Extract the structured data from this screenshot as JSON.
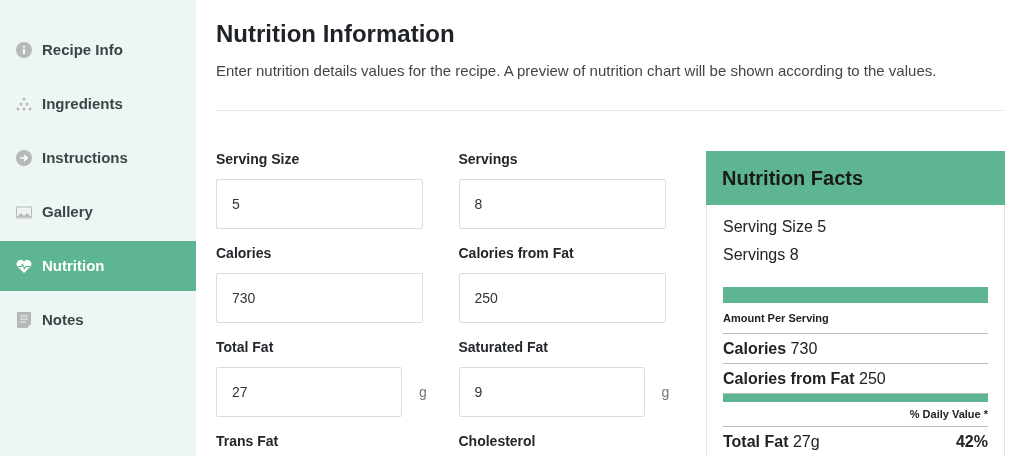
{
  "sidebar": {
    "items": [
      {
        "label": "Recipe Info",
        "selected": false
      },
      {
        "label": "Ingredients",
        "selected": false
      },
      {
        "label": "Instructions",
        "selected": false
      },
      {
        "label": "Gallery",
        "selected": false
      },
      {
        "label": "Nutrition",
        "selected": true
      },
      {
        "label": "Notes",
        "selected": false
      }
    ]
  },
  "header": {
    "title": "Nutrition Information",
    "description": "Enter nutrition details values for the recipe. A preview of nutrition chart will be shown according to the values."
  },
  "fields": [
    {
      "label": "Serving Size",
      "value": "5"
    },
    {
      "label": "Servings",
      "value": "8"
    },
    {
      "label": "Calories",
      "value": "730"
    },
    {
      "label": "Calories from Fat",
      "value": "250"
    },
    {
      "label": "Total Fat",
      "value": "27",
      "unit": "g"
    },
    {
      "label": "Saturated Fat",
      "value": "9",
      "unit": "g"
    },
    {
      "label": "Trans Fat"
    },
    {
      "label": "Cholesterol"
    }
  ],
  "nutrition_facts": {
    "title": "Nutrition Facts",
    "lines": [
      {
        "kind": "plain",
        "text": "Serving Size 5"
      },
      {
        "kind": "plain",
        "text": "Servings 8"
      },
      {
        "kind": "thickbar"
      },
      {
        "kind": "small",
        "text": "Amount Per Serving"
      },
      {
        "kind": "nutrient",
        "name": "Calories",
        "amount": "730"
      },
      {
        "kind": "nutrient",
        "name": "Calories from Fat",
        "amount": "250"
      },
      {
        "kind": "midbar"
      },
      {
        "kind": "right",
        "text": "% Daily Value *"
      },
      {
        "kind": "nutrient",
        "name": "Total Fat",
        "amount": "27g",
        "percent": "42%"
      }
    ]
  }
}
